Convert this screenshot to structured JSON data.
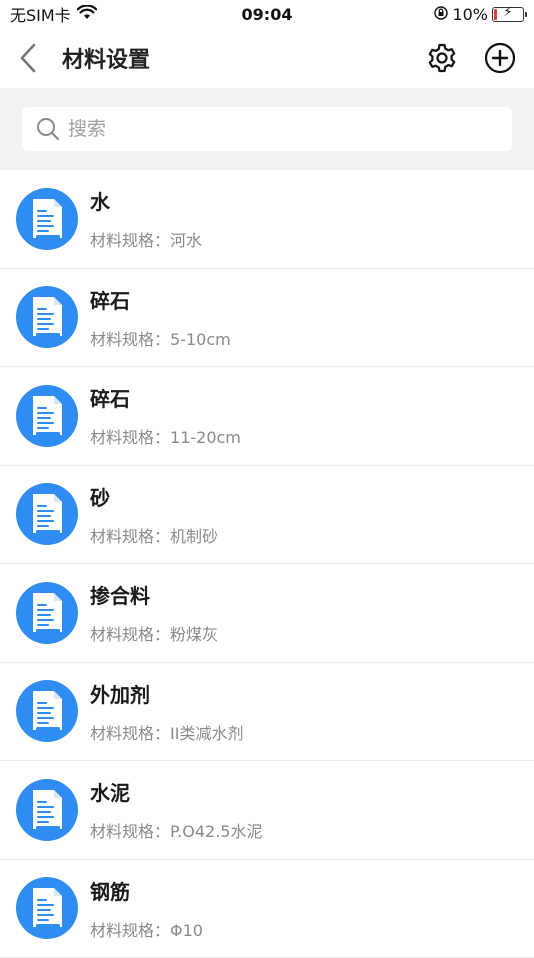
{
  "status": {
    "carrier": "无SIM卡",
    "time": "09:04",
    "battery": "10%",
    "battery_level": 0.1
  },
  "nav": {
    "title": "材料设置"
  },
  "search": {
    "placeholder": "搜索"
  },
  "spec_prefix": "材料规格：",
  "colors": {
    "icon_blue": "#2f8cf0",
    "battery_low": "#e23b3b"
  },
  "items": [
    {
      "name": "水",
      "spec": "河水"
    },
    {
      "name": "碎石",
      "spec": "5-10cm"
    },
    {
      "name": "碎石",
      "spec": "11-20cm"
    },
    {
      "name": "砂",
      "spec": "机制砂"
    },
    {
      "name": "掺合料",
      "spec": "粉煤灰"
    },
    {
      "name": "外加剂",
      "spec": "II类减水剂"
    },
    {
      "name": "水泥",
      "spec": "P.O42.5水泥"
    },
    {
      "name": "钢筋",
      "spec": "Φ10"
    }
  ]
}
